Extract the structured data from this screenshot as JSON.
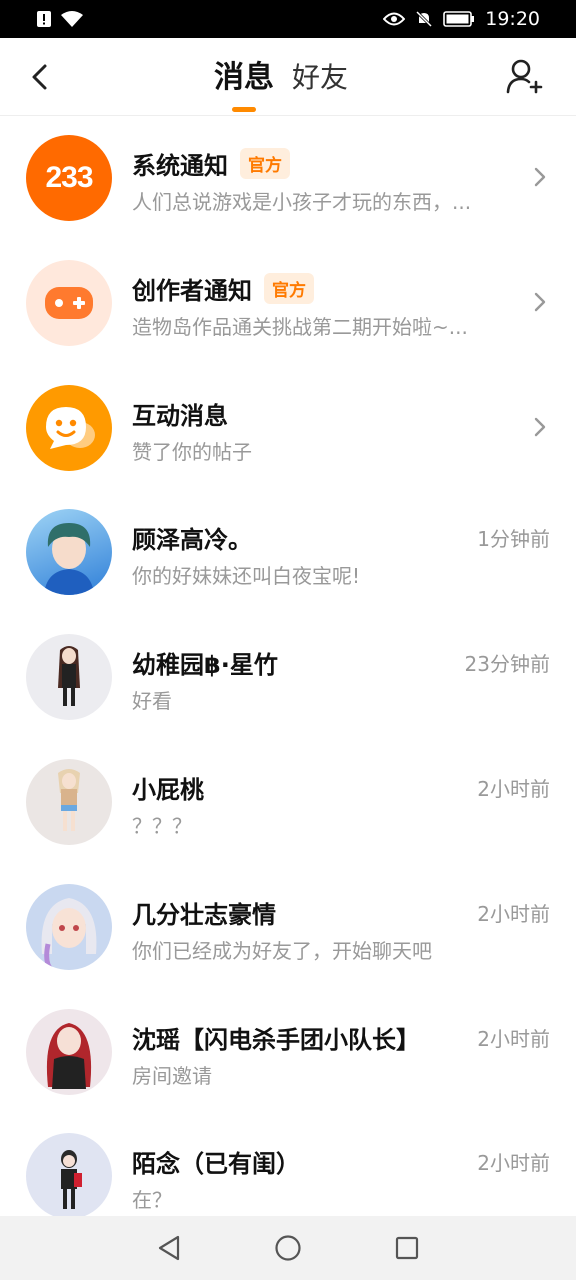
{
  "status_bar": {
    "time": "19:20"
  },
  "header": {
    "tabs": [
      {
        "label": "消息"
      },
      {
        "label": "好友"
      }
    ]
  },
  "messages": [
    {
      "title": "系统通知",
      "badge": "官方",
      "subtitle": "人们总说游戏是小孩子才玩的东西，...",
      "avatar_text": "233",
      "avatar_color": "#ff6a00"
    },
    {
      "title": "创作者通知",
      "badge": "官方",
      "subtitle": "造物岛作品通关挑战第二期开始啦~...",
      "avatar_color": "#ffe8dc"
    },
    {
      "title": "互动消息",
      "subtitle": "赞了你的帖子",
      "avatar_color": "#ff9a00"
    },
    {
      "title": "顾泽高冷。",
      "time": "1分钟前",
      "subtitle": "你的好妹妹还叫白夜宝呢!",
      "avatar_color": "#3a8fe0"
    },
    {
      "title": "幼稚园฿·星竹",
      "time": "23分钟前",
      "subtitle": "好看",
      "avatar_color": "#ececf0"
    },
    {
      "title": "小屁桃",
      "time": "2小时前",
      "subtitle": "？？？",
      "avatar_color": "#ebe6e4"
    },
    {
      "title": "几分壮志豪情",
      "time": "2小时前",
      "subtitle": "你们已经成为好友了，开始聊天吧",
      "avatar_color": "#c9d8f0"
    },
    {
      "title": "沈瑶【闪电杀手团小队长】",
      "time": "2小时前",
      "subtitle": "房间邀请",
      "avatar_color": "#efe6ea"
    },
    {
      "title": "陌念（已有闺）",
      "time": "2小时前",
      "subtitle": "在？",
      "avatar_color": "#e0e4f2"
    }
  ]
}
